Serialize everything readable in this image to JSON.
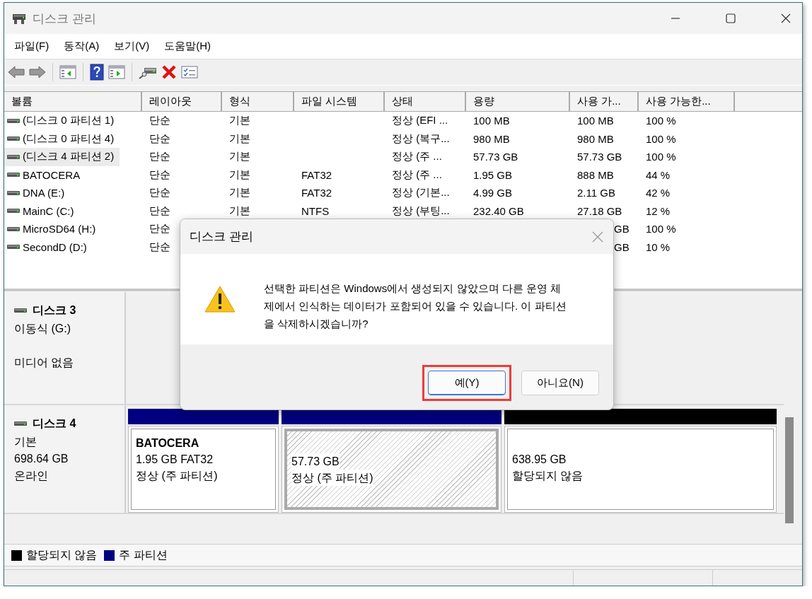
{
  "window": {
    "title": "디스크 관리"
  },
  "menu": [
    "파일(F)",
    "동작(A)",
    "보기(V)",
    "도움말(H)"
  ],
  "table": {
    "columns": [
      "볼륨",
      "레이아웃",
      "형식",
      "파일 시스템",
      "상태",
      "용량",
      "사용 가...",
      "사용 가능한..."
    ],
    "rows": [
      {
        "selected": false,
        "cells": [
          "(디스크 0 파티션 1)",
          "단순",
          "기본",
          null,
          "정상 (EFI ...",
          "100 MB",
          "100 MB",
          "100 %"
        ]
      },
      {
        "selected": false,
        "cells": [
          "(디스크 0 파티션 4)",
          "단순",
          "기본",
          null,
          "정상 (복구...",
          "980 MB",
          "980 MB",
          "100 %"
        ]
      },
      {
        "selected": true,
        "cells": [
          "(디스크 4 파티션 2)",
          "단순",
          "기본",
          null,
          "정상 (주 ...",
          "57.73 GB",
          "57.73 GB",
          "100 %"
        ]
      },
      {
        "selected": false,
        "cells": [
          "BATOCERA",
          "단순",
          "기본",
          "FAT32",
          "정상 (주 ...",
          "1.95 GB",
          "888 MB",
          "44 %"
        ]
      },
      {
        "selected": false,
        "cells": [
          "DNA (E:)",
          "단순",
          "기본",
          "FAT32",
          "정상 (기본...",
          "4.99 GB",
          "2.11 GB",
          "42 %"
        ]
      },
      {
        "selected": false,
        "cells": [
          "MainC (C:)",
          "단순",
          "기본",
          "NTFS",
          "정상 (부팅...",
          "232.40 GB",
          "27.18 GB",
          "12 %"
        ]
      },
      {
        "selected": false,
        "cells": [
          "MicroSD64 (H:)",
          "단순",
          null,
          null,
          null,
          null,
          {
            "kind": "tail",
            "text": "GB"
          },
          "100 %"
        ]
      },
      {
        "selected": false,
        "cells": [
          "SecondD (D:)",
          "단순",
          null,
          null,
          null,
          null,
          {
            "kind": "tail",
            "text": "GB"
          },
          "10 %"
        ]
      }
    ]
  },
  "disks": [
    {
      "name": "디스크 3",
      "type": "이동식 (G:)",
      "status": "미디어 없음"
    },
    {
      "name": "디스크 4",
      "type": "기본",
      "size": "698.64 GB",
      "status": "온라인",
      "partitions": [
        {
          "name": "BATOCERA",
          "size": "1.95 GB FAT32",
          "status": "정상 (주 파티션)",
          "color": "#000080",
          "selected": false
        },
        {
          "size": "57.73 GB",
          "status": "정상 (주 파티션)",
          "color": "#000080",
          "selected": true
        },
        {
          "size": "638.95 GB",
          "status": "할당되지 않음",
          "color": "#000000",
          "selected": false
        }
      ]
    }
  ],
  "legend": [
    {
      "label": "할당되지 않음",
      "color": "#000000"
    },
    {
      "label": "주 파티션",
      "color": "#000080"
    }
  ],
  "dialog": {
    "title": "디스크 관리",
    "message": "선택한 파티션은 Windows에서 생성되지 않았으며 다른 운영 체제에서 인식하는 데이터가 포함되어 있을 수 있습니다. 이 파티션을 삭제하시겠습니까?",
    "buttons": [
      {
        "label": "예(Y)",
        "default": true,
        "highlighted": true
      },
      {
        "label": "아니요(N)",
        "default": false,
        "highlighted": false
      }
    ]
  }
}
